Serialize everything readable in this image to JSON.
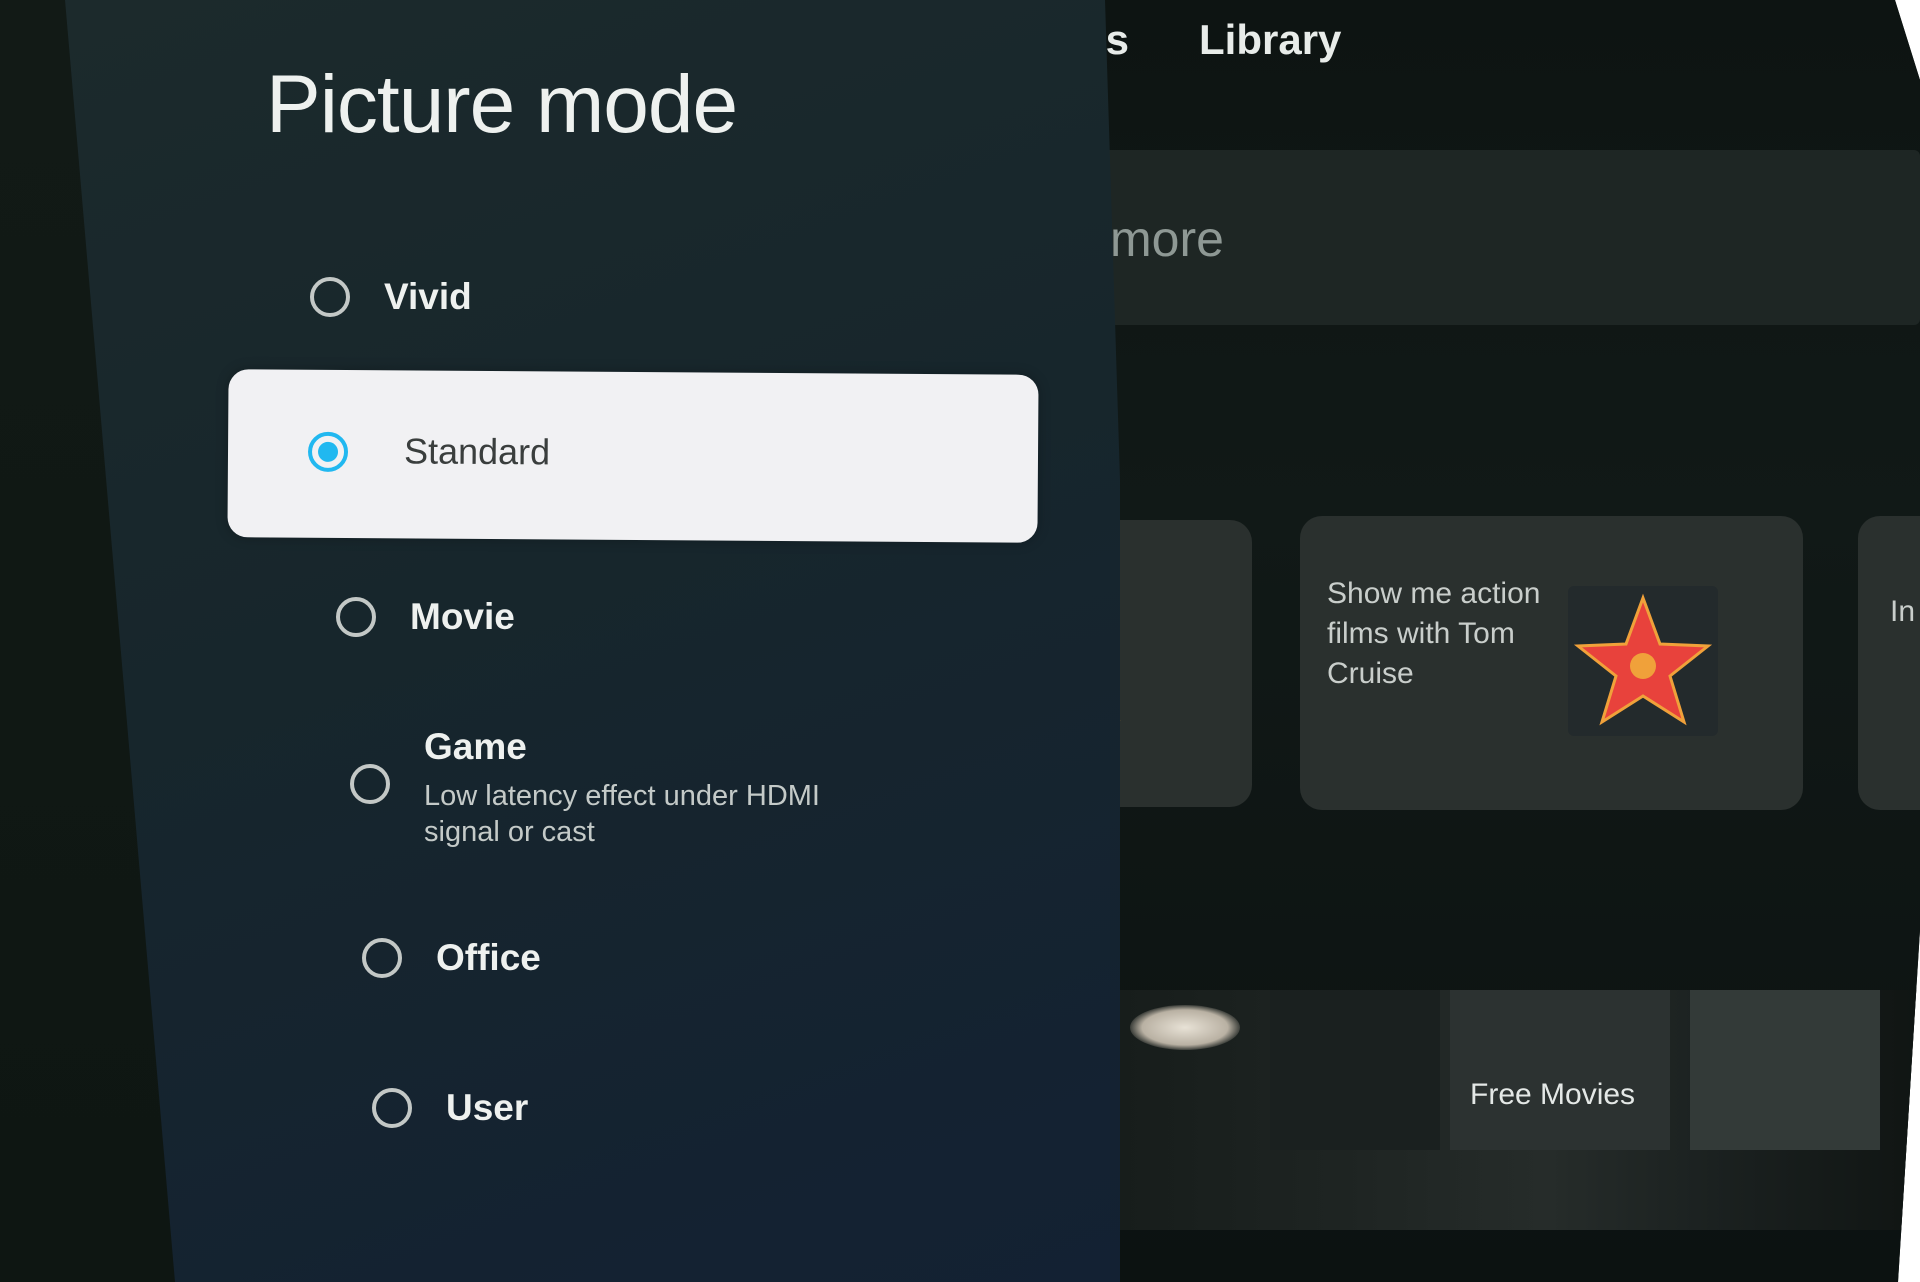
{
  "home": {
    "nav": [
      "ps",
      "Library"
    ],
    "search_hint": "more",
    "cards": [
      {
        "text": "Show me action films with Tom Cruise"
      },
      {
        "text": "In we re"
      }
    ],
    "movies_label": "Free Movies"
  },
  "picture_mode": {
    "title": "Picture mode",
    "options": [
      {
        "label": "Vivid"
      },
      {
        "label": "Standard",
        "selected": true
      },
      {
        "label": "Movie"
      },
      {
        "label": "Game",
        "description": "Low latency effect under HDMI signal or cast"
      },
      {
        "label": "Office"
      },
      {
        "label": "User"
      }
    ]
  },
  "colors": {
    "accent": "#21b8f0",
    "star": "#e8423c",
    "star_center": "#f0a13a"
  },
  "icons": [
    "radio-unchecked-icon",
    "radio-checked-icon",
    "star-icon",
    "swords-icon"
  ]
}
